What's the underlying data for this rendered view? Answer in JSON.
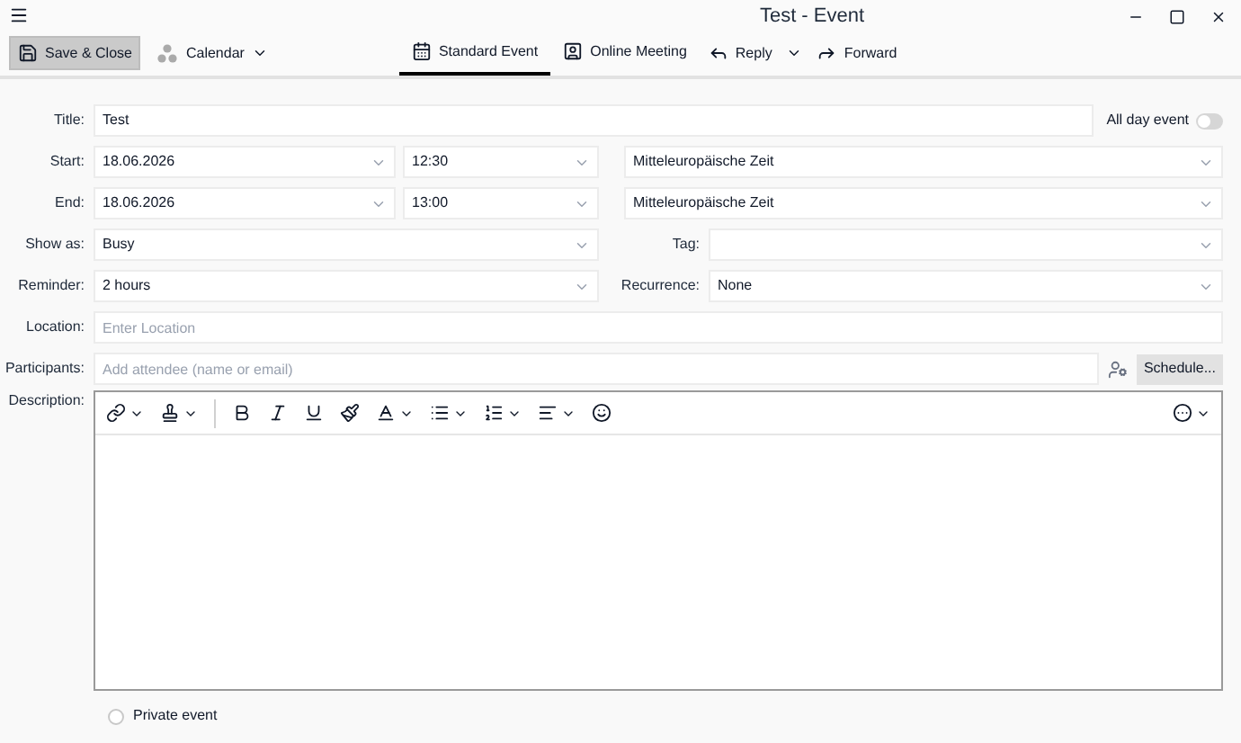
{
  "window": {
    "title": "Test - Event"
  },
  "toolbar": {
    "save_close": "Save & Close",
    "calendar": "Calendar",
    "tabs": [
      {
        "label": "Standard Event",
        "selected": true,
        "kind": "calendar"
      },
      {
        "label": "Online Meeting",
        "selected": false,
        "kind": "meeting"
      }
    ],
    "reply": "Reply",
    "forward": "Forward"
  },
  "form": {
    "title": {
      "label": "Title:",
      "value": "Test"
    },
    "all_day": {
      "label": "All day event",
      "on": false
    },
    "start": {
      "label": "Start:",
      "date": "18.06.2026",
      "time": "12:30",
      "timezone": "Mitteleuropäische Zeit"
    },
    "end": {
      "label": "End:",
      "date": "18.06.2026",
      "time": "13:00",
      "timezone": "Mitteleuropäische Zeit"
    },
    "show_as": {
      "label": "Show as:",
      "value": "Busy"
    },
    "tag": {
      "label": "Tag:"
    },
    "reminder": {
      "label": "Reminder:",
      "value": "2 hours"
    },
    "recurrence": {
      "label": "Recurrence:",
      "value": "None"
    },
    "location": {
      "label": "Location:",
      "placeholder": "Enter Location"
    },
    "participants": {
      "label": "Participants:",
      "placeholder": "Add attendee (name or email)",
      "button": "Schedule..."
    },
    "description": {
      "label": "Description:"
    },
    "private_event": {
      "label": "Private event",
      "checked": false
    }
  }
}
